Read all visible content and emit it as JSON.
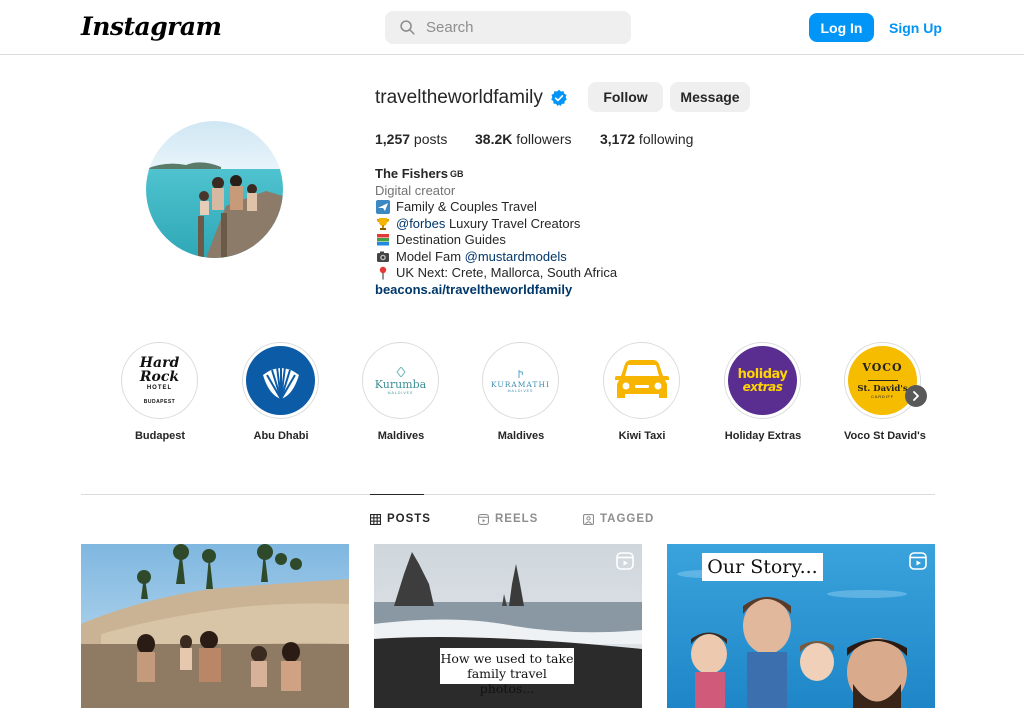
{
  "nav": {
    "logo": "Instagram",
    "search_placeholder": "Search",
    "login_label": "Log In",
    "signup_label": "Sign Up"
  },
  "profile": {
    "username": "traveltheworldfamily",
    "follow_label": "Follow",
    "message_label": "Message",
    "stats": {
      "posts_count": "1,257",
      "posts_label": " posts",
      "followers_count": "38.2K",
      "followers_label": " followers",
      "following_count": "3,172",
      "following_label": " following"
    },
    "bio": {
      "name": "The Fishers",
      "flag": "GB",
      "category": "Digital creator",
      "line1": "Family & Couples Travel",
      "line2_mention": "@forbes",
      "line2_text": " Luxury Travel Creators",
      "line3": "Destination Guides",
      "line4_text": "Model Fam ",
      "line4_mention": "@mustardmodels",
      "line5": "UK Next: Crete, Mallorca, South Africa",
      "link": "beacons.ai/traveltheworldfamily"
    }
  },
  "highlights": [
    {
      "label": "Budapest",
      "logo_text": "Hard Rock",
      "logo_sub": "HOTEL",
      "logo_sub2": "BUDAPEST"
    },
    {
      "label": "Abu Dhabi"
    },
    {
      "label": "Maldives",
      "logo_text": "Kurumba",
      "logo_sub": "MALDIVES"
    },
    {
      "label": "Maldives",
      "logo_text": "KURAMATHI",
      "logo_sub": "MALDIVES"
    },
    {
      "label": "Kiwi Taxi"
    },
    {
      "label": "Holiday Extras",
      "logo_text": "holiday",
      "logo_sub": "extras"
    },
    {
      "label": "Voco St David's",
      "logo_text": "VOCO",
      "logo_sub": "St. David's",
      "logo_sub2": "CARDIFF"
    }
  ],
  "tabs": [
    {
      "label": "POSTS",
      "active": true
    },
    {
      "label": "REELS",
      "active": false
    },
    {
      "label": "TAGGED",
      "active": false
    }
  ],
  "posts": [
    {
      "caption": ""
    },
    {
      "caption_line1": "How we used to take",
      "caption_line2": "family travel photos..."
    },
    {
      "caption": "Our Story..."
    }
  ],
  "colors": {
    "accent": "#0095f6",
    "link": "#00376b",
    "border": "#dbdbdb",
    "button_bg": "#efefef"
  }
}
